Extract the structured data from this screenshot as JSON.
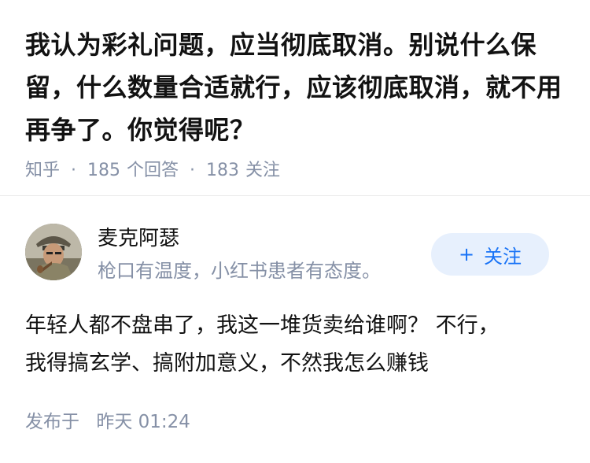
{
  "question": {
    "title": "我认为彩礼问题，应当彻底取消。别说什么保留，什么数量合适就行，应该彻底取消，就不用再争了。你觉得呢？",
    "source": "知乎",
    "answer_count": "185",
    "answer_label": "个回答",
    "follow_count": "183",
    "follow_label": "关注"
  },
  "author": {
    "name": "麦克阿瑟",
    "bio": "枪口有温度，小红书患者有态度。",
    "follow_button": "关注",
    "follow_icon": "plus-icon"
  },
  "answer": {
    "lines": [
      "年轻人都不盘串了，我这一堆货卖给谁啊？ 不行，",
      "我得搞玄学、搞附加意义，不然我怎么赚钱"
    ],
    "published_label": "发布于",
    "published_day": "昨天",
    "published_time": "01:24"
  },
  "colors": {
    "accent": "#1772f6",
    "accent_bg": "#e7f0fd",
    "meta": "#8590a6",
    "text": "#121212"
  }
}
